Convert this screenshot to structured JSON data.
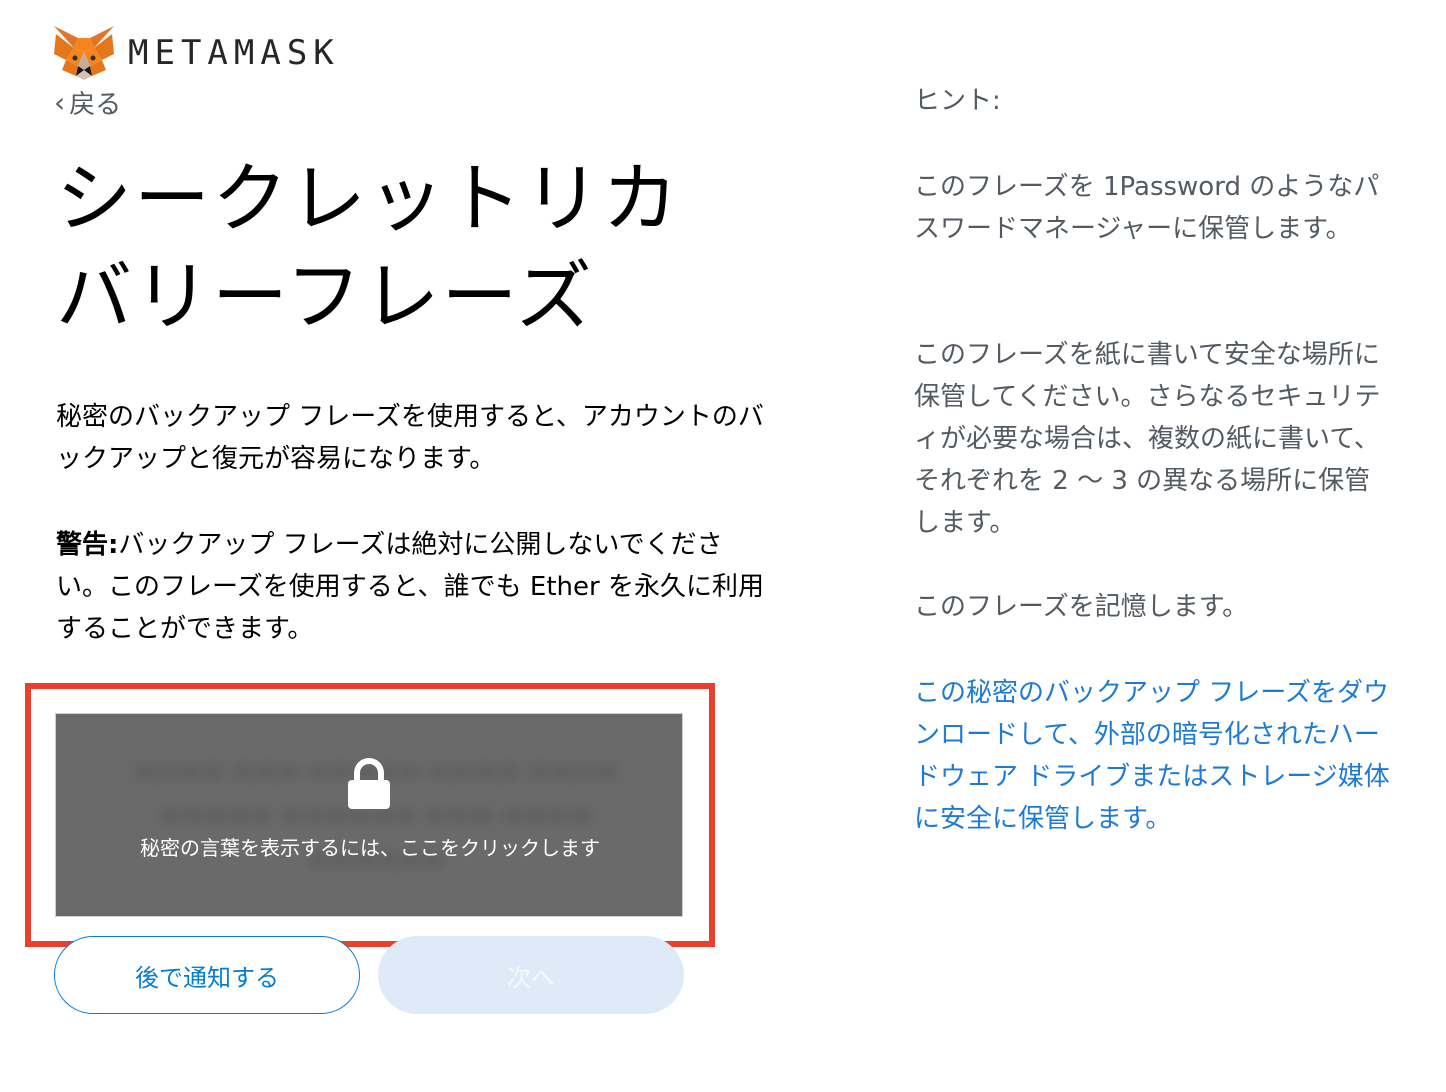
{
  "brand": {
    "name": "METAMASK",
    "logo_icon": "metamask-fox-icon"
  },
  "nav": {
    "back_label": "戻る",
    "back_icon": "chevron-left-icon"
  },
  "main": {
    "title": "シークレットリカバリーフレーズ",
    "description": "秘密のバックアップ フレーズを使用すると、アカウントのバックアップと復元が容易になります。",
    "warning_label": "警告:",
    "warning_text": "バックアップ フレーズは絶対に公開しないでください。このフレーズを使用すると、誰でも Ether を永久に利用することができます。",
    "secret_box": {
      "lock_icon": "lock-icon",
      "reveal_label": "秘密の言葉を表示するには、ここをクリックします",
      "highlight_color": "#e8402a"
    },
    "buttons": {
      "remind_later": "後で通知する",
      "next": "次へ"
    }
  },
  "hints": {
    "heading": "ヒント:",
    "tip1": "このフレーズを 1Password のようなパスワードマネージャーに保管します。",
    "tip2": "このフレーズを紙に書いて安全な場所に保管してください。さらなるセキュリティが必要な場合は、複数の紙に書いて、それぞれを 2 〜 3 の異なる場所に保管します。",
    "tip3": "このフレーズを記憶します。",
    "download_link": "この秘密のバックアップ フレーズをダウンロードして、外部の暗号化されたハードウェア ドライブまたはストレージ媒体に安全に保管します。"
  },
  "colors": {
    "accent": "#037dd6",
    "link": "#1d7bd6",
    "disabled_button": "#dfeaf8"
  }
}
